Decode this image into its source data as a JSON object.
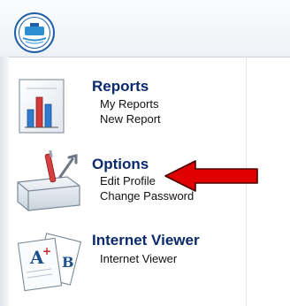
{
  "sections": [
    {
      "title": "Reports",
      "icon": "bar-chart-icon",
      "links": [
        "My Reports",
        "New Report"
      ]
    },
    {
      "title": "Options",
      "icon": "toolbox-icon",
      "links": [
        "Edit Profile",
        "Change Password"
      ]
    },
    {
      "title": "Internet Viewer",
      "icon": "graded-papers-icon",
      "links": [
        "Internet Viewer"
      ]
    }
  ],
  "logo": {
    "icon": "school-district-seal-logo"
  },
  "annotation": {
    "icon": "red-arrow-icon",
    "color": "#e10000"
  },
  "colors": {
    "title": "#0a2a6b",
    "link": "#111111",
    "accent": "#1a6fb0"
  }
}
